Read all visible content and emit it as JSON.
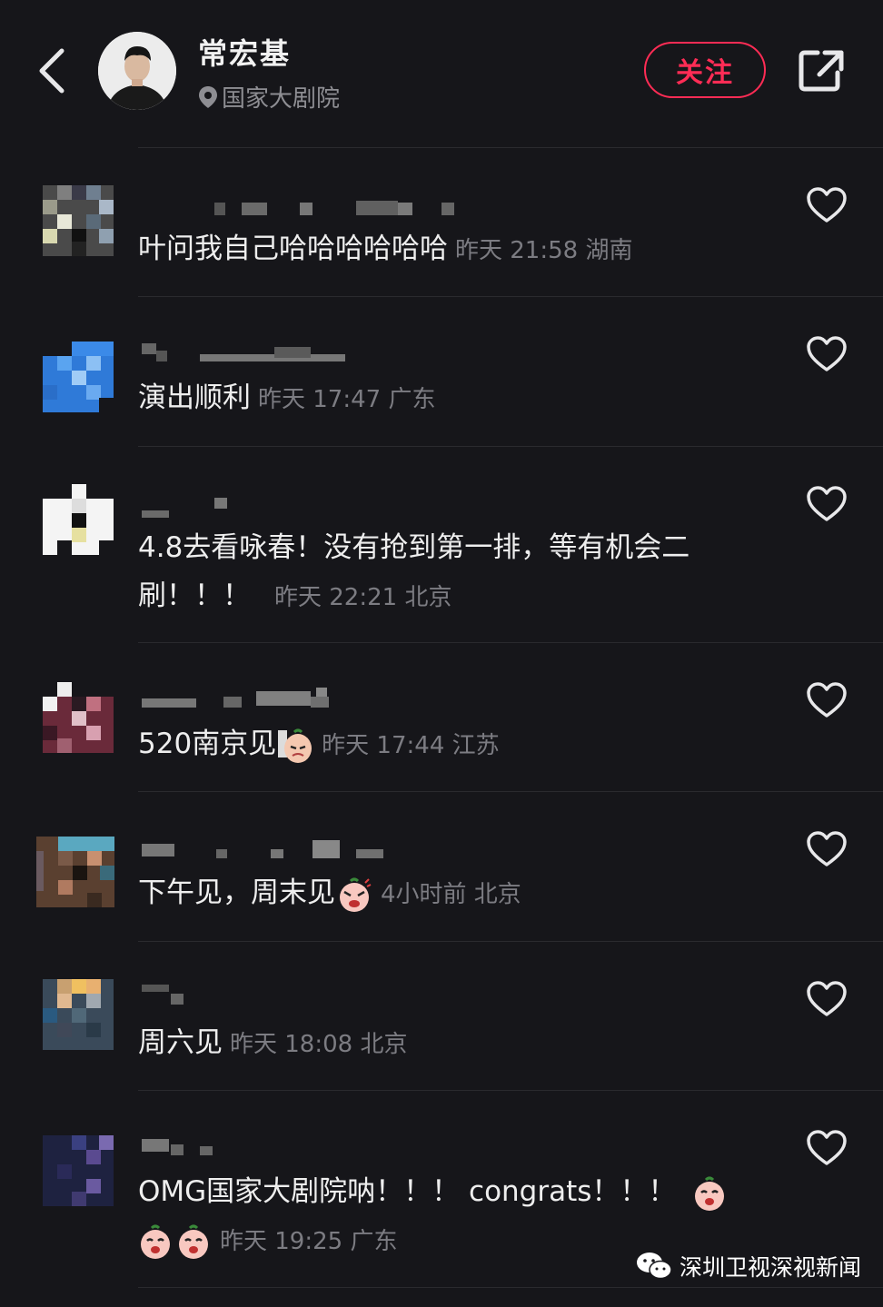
{
  "header": {
    "name": "常宏基",
    "location": "国家大剧院",
    "follow_label": "关注"
  },
  "comments": [
    {
      "text": "叶问我自己哈哈哈哈哈哈",
      "meta": "昨天 21:58 湖南"
    },
    {
      "text": "演出顺利",
      "meta": "昨天 17:47 广东"
    },
    {
      "text": "4.8去看咏春！没有抢到第一排，等有机会二刷！！！",
      "meta": "昨天 22:21 北京"
    },
    {
      "text": "520南京见",
      "meta": "昨天 17:44 江苏"
    },
    {
      "text": "下午见，周末见",
      "meta": "4小时前 北京"
    },
    {
      "text": "周六见",
      "meta": "昨天 18:08 北京"
    },
    {
      "text": "OMG国家大剧院呐！！！ congrats！！！",
      "meta": "昨天 19:25 广东"
    }
  ],
  "watermark": {
    "text": "深圳卫视深视新闻"
  },
  "colors": {
    "background": "#16161a",
    "follow_accent": "#ff2c55",
    "meta_text": "#7c7c82"
  }
}
